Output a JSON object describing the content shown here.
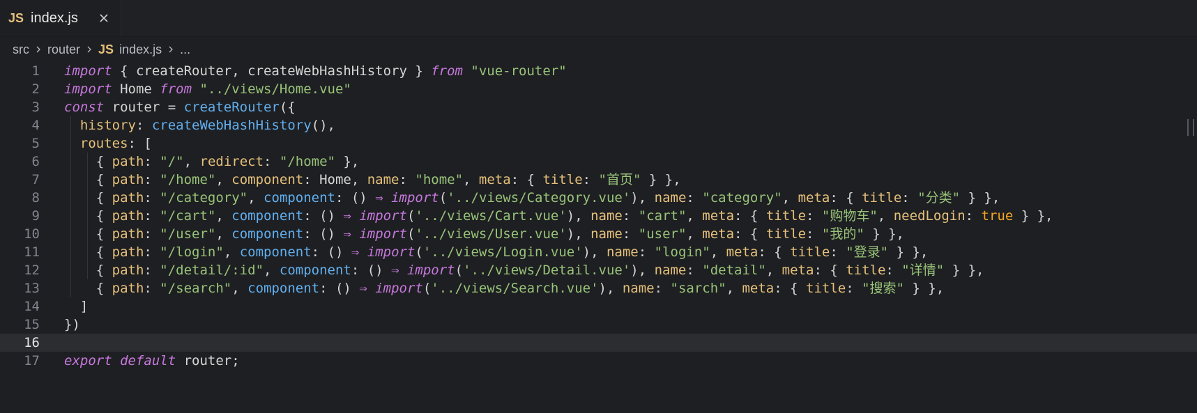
{
  "tab": {
    "icon_text": "JS",
    "label": "index.js"
  },
  "breadcrumb": {
    "items": [
      "src",
      "router",
      "index.js",
      "..."
    ],
    "file_icon_text": "JS"
  },
  "editor": {
    "current_line": 16,
    "lines": [
      {
        "number": "1",
        "segments": [
          {
            "t": "import",
            "c": "kw"
          },
          {
            "t": " { createRouter, createWebHashHistory } ",
            "c": "punct"
          },
          {
            "t": "from",
            "c": "kw"
          },
          {
            "t": " ",
            "c": "punct"
          },
          {
            "t": "\"vue-router\"",
            "c": "str"
          }
        ]
      },
      {
        "number": "2",
        "segments": [
          {
            "t": "import",
            "c": "kw"
          },
          {
            "t": " Home ",
            "c": "punct"
          },
          {
            "t": "from",
            "c": "kw"
          },
          {
            "t": " ",
            "c": "punct"
          },
          {
            "t": "\"../views/Home.vue\"",
            "c": "str"
          }
        ]
      },
      {
        "number": "3",
        "segments": [
          {
            "t": "const",
            "c": "kw"
          },
          {
            "t": " router = ",
            "c": "punct"
          },
          {
            "t": "createRouter",
            "c": "fn"
          },
          {
            "t": "({",
            "c": "punct"
          }
        ]
      },
      {
        "number": "4",
        "segments": [
          {
            "t": "  ",
            "c": "punct"
          },
          {
            "t": "history",
            "c": "prop"
          },
          {
            "t": ": ",
            "c": "punct"
          },
          {
            "t": "createWebHashHistory",
            "c": "fn"
          },
          {
            "t": "(),",
            "c": "punct"
          }
        ]
      },
      {
        "number": "5",
        "segments": [
          {
            "t": "  ",
            "c": "punct"
          },
          {
            "t": "routes",
            "c": "prop"
          },
          {
            "t": ": [",
            "c": "punct"
          }
        ]
      },
      {
        "number": "6",
        "segments": [
          {
            "t": "    { ",
            "c": "punct"
          },
          {
            "t": "path",
            "c": "prop"
          },
          {
            "t": ": ",
            "c": "punct"
          },
          {
            "t": "\"/\"",
            "c": "str"
          },
          {
            "t": ", ",
            "c": "punct"
          },
          {
            "t": "redirect",
            "c": "prop"
          },
          {
            "t": ": ",
            "c": "punct"
          },
          {
            "t": "\"/home\"",
            "c": "str"
          },
          {
            "t": " },",
            "c": "punct"
          }
        ]
      },
      {
        "number": "7",
        "segments": [
          {
            "t": "    { ",
            "c": "punct"
          },
          {
            "t": "path",
            "c": "prop"
          },
          {
            "t": ": ",
            "c": "punct"
          },
          {
            "t": "\"/home\"",
            "c": "str"
          },
          {
            "t": ", ",
            "c": "punct"
          },
          {
            "t": "component",
            "c": "prop"
          },
          {
            "t": ": Home, ",
            "c": "punct"
          },
          {
            "t": "name",
            "c": "prop"
          },
          {
            "t": ": ",
            "c": "punct"
          },
          {
            "t": "\"home\"",
            "c": "str"
          },
          {
            "t": ", ",
            "c": "punct"
          },
          {
            "t": "meta",
            "c": "prop"
          },
          {
            "t": ": { ",
            "c": "punct"
          },
          {
            "t": "title",
            "c": "prop"
          },
          {
            "t": ": ",
            "c": "punct"
          },
          {
            "t": "\"首页\"",
            "c": "str"
          },
          {
            "t": " } },",
            "c": "punct"
          }
        ]
      },
      {
        "number": "8",
        "segments": [
          {
            "t": "    { ",
            "c": "punct"
          },
          {
            "t": "path",
            "c": "prop"
          },
          {
            "t": ": ",
            "c": "punct"
          },
          {
            "t": "\"/category\"",
            "c": "str"
          },
          {
            "t": ", ",
            "c": "punct"
          },
          {
            "t": "component",
            "c": "fn"
          },
          {
            "t": ": () ",
            "c": "punct"
          },
          {
            "t": "⇒",
            "c": "arrow"
          },
          {
            "t": " ",
            "c": "punct"
          },
          {
            "t": "import",
            "c": "kw"
          },
          {
            "t": "(",
            "c": "punct"
          },
          {
            "t": "'../views/Category.vue'",
            "c": "str"
          },
          {
            "t": "), ",
            "c": "punct"
          },
          {
            "t": "name",
            "c": "prop"
          },
          {
            "t": ": ",
            "c": "punct"
          },
          {
            "t": "\"category\"",
            "c": "str"
          },
          {
            "t": ", ",
            "c": "punct"
          },
          {
            "t": "meta",
            "c": "prop"
          },
          {
            "t": ": { ",
            "c": "punct"
          },
          {
            "t": "title",
            "c": "prop"
          },
          {
            "t": ": ",
            "c": "punct"
          },
          {
            "t": "\"分类\"",
            "c": "str"
          },
          {
            "t": " } },",
            "c": "punct"
          }
        ]
      },
      {
        "number": "9",
        "segments": [
          {
            "t": "    { ",
            "c": "punct"
          },
          {
            "t": "path",
            "c": "prop"
          },
          {
            "t": ": ",
            "c": "punct"
          },
          {
            "t": "\"/cart\"",
            "c": "str"
          },
          {
            "t": ", ",
            "c": "punct"
          },
          {
            "t": "component",
            "c": "fn"
          },
          {
            "t": ": () ",
            "c": "punct"
          },
          {
            "t": "⇒",
            "c": "arrow"
          },
          {
            "t": " ",
            "c": "punct"
          },
          {
            "t": "import",
            "c": "kw"
          },
          {
            "t": "(",
            "c": "punct"
          },
          {
            "t": "'../views/Cart.vue'",
            "c": "str"
          },
          {
            "t": "), ",
            "c": "punct"
          },
          {
            "t": "name",
            "c": "prop"
          },
          {
            "t": ": ",
            "c": "punct"
          },
          {
            "t": "\"cart\"",
            "c": "str"
          },
          {
            "t": ", ",
            "c": "punct"
          },
          {
            "t": "meta",
            "c": "prop"
          },
          {
            "t": ": { ",
            "c": "punct"
          },
          {
            "t": "title",
            "c": "prop"
          },
          {
            "t": ": ",
            "c": "punct"
          },
          {
            "t": "\"购物车\"",
            "c": "str"
          },
          {
            "t": ", ",
            "c": "punct"
          },
          {
            "t": "needLogin",
            "c": "prop"
          },
          {
            "t": ": ",
            "c": "punct"
          },
          {
            "t": "true",
            "c": "bool"
          },
          {
            "t": " } },",
            "c": "punct"
          }
        ]
      },
      {
        "number": "10",
        "segments": [
          {
            "t": "    { ",
            "c": "punct"
          },
          {
            "t": "path",
            "c": "prop"
          },
          {
            "t": ": ",
            "c": "punct"
          },
          {
            "t": "\"/user\"",
            "c": "str"
          },
          {
            "t": ", ",
            "c": "punct"
          },
          {
            "t": "component",
            "c": "fn"
          },
          {
            "t": ": () ",
            "c": "punct"
          },
          {
            "t": "⇒",
            "c": "arrow"
          },
          {
            "t": " ",
            "c": "punct"
          },
          {
            "t": "import",
            "c": "kw"
          },
          {
            "t": "(",
            "c": "punct"
          },
          {
            "t": "'../views/User.vue'",
            "c": "str"
          },
          {
            "t": "), ",
            "c": "punct"
          },
          {
            "t": "name",
            "c": "prop"
          },
          {
            "t": ": ",
            "c": "punct"
          },
          {
            "t": "\"user\"",
            "c": "str"
          },
          {
            "t": ", ",
            "c": "punct"
          },
          {
            "t": "meta",
            "c": "prop"
          },
          {
            "t": ": { ",
            "c": "punct"
          },
          {
            "t": "title",
            "c": "prop"
          },
          {
            "t": ": ",
            "c": "punct"
          },
          {
            "t": "\"我的\"",
            "c": "str"
          },
          {
            "t": " } },",
            "c": "punct"
          }
        ]
      },
      {
        "number": "11",
        "segments": [
          {
            "t": "    { ",
            "c": "punct"
          },
          {
            "t": "path",
            "c": "prop"
          },
          {
            "t": ": ",
            "c": "punct"
          },
          {
            "t": "\"/login\"",
            "c": "str"
          },
          {
            "t": ", ",
            "c": "punct"
          },
          {
            "t": "component",
            "c": "fn"
          },
          {
            "t": ": () ",
            "c": "punct"
          },
          {
            "t": "⇒",
            "c": "arrow"
          },
          {
            "t": " ",
            "c": "punct"
          },
          {
            "t": "import",
            "c": "kw"
          },
          {
            "t": "(",
            "c": "punct"
          },
          {
            "t": "'../views/Login.vue'",
            "c": "str"
          },
          {
            "t": "), ",
            "c": "punct"
          },
          {
            "t": "name",
            "c": "prop"
          },
          {
            "t": ": ",
            "c": "punct"
          },
          {
            "t": "\"login\"",
            "c": "str"
          },
          {
            "t": ", ",
            "c": "punct"
          },
          {
            "t": "meta",
            "c": "prop"
          },
          {
            "t": ": { ",
            "c": "punct"
          },
          {
            "t": "title",
            "c": "prop"
          },
          {
            "t": ": ",
            "c": "punct"
          },
          {
            "t": "\"登录\"",
            "c": "str"
          },
          {
            "t": " } },",
            "c": "punct"
          }
        ]
      },
      {
        "number": "12",
        "segments": [
          {
            "t": "    { ",
            "c": "punct"
          },
          {
            "t": "path",
            "c": "prop"
          },
          {
            "t": ": ",
            "c": "punct"
          },
          {
            "t": "\"/detail/:id\"",
            "c": "str"
          },
          {
            "t": ", ",
            "c": "punct"
          },
          {
            "t": "component",
            "c": "fn"
          },
          {
            "t": ": () ",
            "c": "punct"
          },
          {
            "t": "⇒",
            "c": "arrow"
          },
          {
            "t": " ",
            "c": "punct"
          },
          {
            "t": "import",
            "c": "kw"
          },
          {
            "t": "(",
            "c": "punct"
          },
          {
            "t": "'../views/Detail.vue'",
            "c": "str"
          },
          {
            "t": "), ",
            "c": "punct"
          },
          {
            "t": "name",
            "c": "prop"
          },
          {
            "t": ": ",
            "c": "punct"
          },
          {
            "t": "\"detail\"",
            "c": "str"
          },
          {
            "t": ", ",
            "c": "punct"
          },
          {
            "t": "meta",
            "c": "prop"
          },
          {
            "t": ": { ",
            "c": "punct"
          },
          {
            "t": "title",
            "c": "prop"
          },
          {
            "t": ": ",
            "c": "punct"
          },
          {
            "t": "\"详情\"",
            "c": "str"
          },
          {
            "t": " } },",
            "c": "punct"
          }
        ]
      },
      {
        "number": "13",
        "segments": [
          {
            "t": "    { ",
            "c": "punct"
          },
          {
            "t": "path",
            "c": "prop"
          },
          {
            "t": ": ",
            "c": "punct"
          },
          {
            "t": "\"/search\"",
            "c": "str"
          },
          {
            "t": ", ",
            "c": "punct"
          },
          {
            "t": "component",
            "c": "fn"
          },
          {
            "t": ": () ",
            "c": "punct"
          },
          {
            "t": "⇒",
            "c": "arrow"
          },
          {
            "t": " ",
            "c": "punct"
          },
          {
            "t": "import",
            "c": "kw"
          },
          {
            "t": "(",
            "c": "punct"
          },
          {
            "t": "'../views/Search.vue'",
            "c": "str"
          },
          {
            "t": "), ",
            "c": "punct"
          },
          {
            "t": "name",
            "c": "prop"
          },
          {
            "t": ": ",
            "c": "punct"
          },
          {
            "t": "\"sarch\"",
            "c": "str"
          },
          {
            "t": ", ",
            "c": "punct"
          },
          {
            "t": "meta",
            "c": "prop"
          },
          {
            "t": ": { ",
            "c": "punct"
          },
          {
            "t": "title",
            "c": "prop"
          },
          {
            "t": ": ",
            "c": "punct"
          },
          {
            "t": "\"搜索\"",
            "c": "str"
          },
          {
            "t": " } },",
            "c": "punct"
          }
        ]
      },
      {
        "number": "14",
        "segments": [
          {
            "t": "  ]",
            "c": "punct"
          }
        ]
      },
      {
        "number": "15",
        "segments": [
          {
            "t": "})",
            "c": "punct"
          }
        ]
      },
      {
        "number": "16",
        "segments": []
      },
      {
        "number": "17",
        "segments": [
          {
            "t": "export",
            "c": "kw"
          },
          {
            "t": " ",
            "c": "punct"
          },
          {
            "t": "default",
            "c": "kw"
          },
          {
            "t": " router;",
            "c": "punct"
          }
        ]
      }
    ]
  },
  "colors": {
    "background": "#1e1f22",
    "keyword": "#c678dd",
    "string": "#98c379",
    "function": "#61afef",
    "property": "#e5c07b",
    "boolean": "#f5a623",
    "line_number": "#7f848e"
  }
}
